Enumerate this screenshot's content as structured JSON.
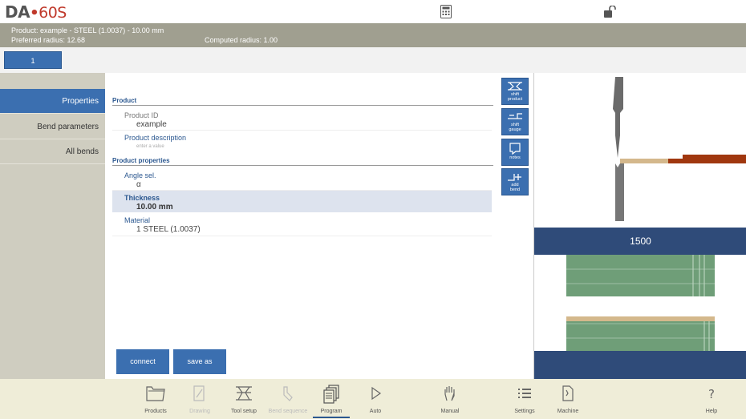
{
  "app": {
    "logo_brand": "DA",
    "logo_dot": "•",
    "logo_model": "60S"
  },
  "infobar": {
    "product_line": "Product: example - STEEL (1.0037) - 10.00 mm",
    "preferred_radius": "Preferred radius: 12.68",
    "computed_radius": "Computed radius: 1.00"
  },
  "bend_tabs": [
    "1"
  ],
  "sidebar": {
    "items": [
      {
        "label": "Properties",
        "active": true
      },
      {
        "label": "Bend parameters",
        "active": false
      },
      {
        "label": "All bends",
        "active": false
      }
    ]
  },
  "form": {
    "section_product": "Product",
    "product_id_label": "Product ID",
    "product_id_value": "example",
    "product_desc_label": "Product description",
    "product_desc_placeholder": "enter a value",
    "section_properties": "Product properties",
    "angle_label": "Angle sel.",
    "angle_value": "α",
    "thickness_label": "Thickness",
    "thickness_value": "10.00 mm",
    "material_label": "Material",
    "material_value": "1 STEEL (1.0037)"
  },
  "buttons": {
    "connect": "connect",
    "save_as": "save as"
  },
  "tools": [
    {
      "line1": "shift",
      "line2": "product"
    },
    {
      "line1": "shift",
      "line2": "gauge"
    },
    {
      "line1": "notes",
      "line2": ""
    },
    {
      "line1": "add",
      "line2": "bend"
    }
  ],
  "preview": {
    "dimension": "1500",
    "colors": {
      "dark_blue": "#2f4b79",
      "sheet_green": "#6f9e78",
      "gauge_brown": "#a0370f",
      "sheet_tan": "#d4b88c",
      "tool_grey": "#777777"
    }
  },
  "bottom_nav": [
    {
      "label": "Products",
      "icon": "folder-icon",
      "enabled": true,
      "active": false
    },
    {
      "label": "Drawing",
      "icon": "pencil-icon",
      "enabled": false,
      "active": false
    },
    {
      "label": "Tool setup",
      "icon": "tool-setup-icon",
      "enabled": true,
      "active": false
    },
    {
      "label": "Bend sequence",
      "icon": "bend-sequence-icon",
      "enabled": false,
      "active": false
    },
    {
      "label": "Program",
      "icon": "program-icon",
      "enabled": true,
      "active": true
    },
    {
      "label": "Auto",
      "icon": "play-icon",
      "enabled": true,
      "active": false
    },
    {
      "label": "Manual",
      "icon": "hand-icon",
      "enabled": true,
      "active": false
    },
    {
      "label": "Settings",
      "icon": "list-icon",
      "enabled": true,
      "active": false
    },
    {
      "label": "Machine",
      "icon": "machine-icon",
      "enabled": true,
      "active": false
    },
    {
      "label": "Help",
      "icon": "help-icon",
      "enabled": true,
      "active": false
    }
  ]
}
